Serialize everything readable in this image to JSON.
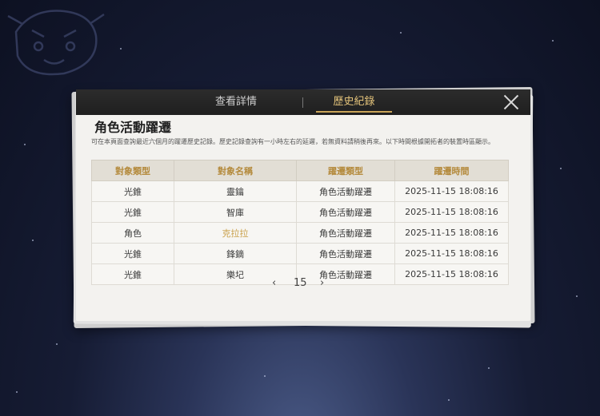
{
  "tabs": {
    "details": "查看詳情",
    "history": "歷史紀錄"
  },
  "title": "角色活動躍遷",
  "description": "可在本頁面查詢最近六個月的躍遷歷史記錄。歷史記錄查詢有一小時左右的延遲，若無資料請稍後再來。以下時間根據開拓者的裝置時區顯示。",
  "table": {
    "headers": [
      "對象類型",
      "對象名稱",
      "躍遷類型",
      "躍遷時間"
    ],
    "rows": [
      {
        "type": "光錐",
        "name": "靈鑰",
        "warp": "角色活動躍遷",
        "time": "2025-11-15 18:08:16",
        "highlight": false
      },
      {
        "type": "光錐",
        "name": "智庫",
        "warp": "角色活動躍遷",
        "time": "2025-11-15 18:08:16",
        "highlight": false
      },
      {
        "type": "角色",
        "name": "克拉拉",
        "warp": "角色活動躍遷",
        "time": "2025-11-15 18:08:16",
        "highlight": true
      },
      {
        "type": "光錐",
        "name": "鋒鏑",
        "warp": "角色活動躍遷",
        "time": "2025-11-15 18:08:16",
        "highlight": false
      },
      {
        "type": "光錐",
        "name": "樂圮",
        "warp": "角色活動躍遷",
        "time": "2025-11-15 18:08:16",
        "highlight": false
      }
    ]
  },
  "pager": {
    "prev": "‹",
    "page": "15",
    "next": "›"
  },
  "colors": {
    "accent": "#c9a458",
    "highlight_text": "#c9a04a",
    "header_text": "#b48a3c"
  }
}
